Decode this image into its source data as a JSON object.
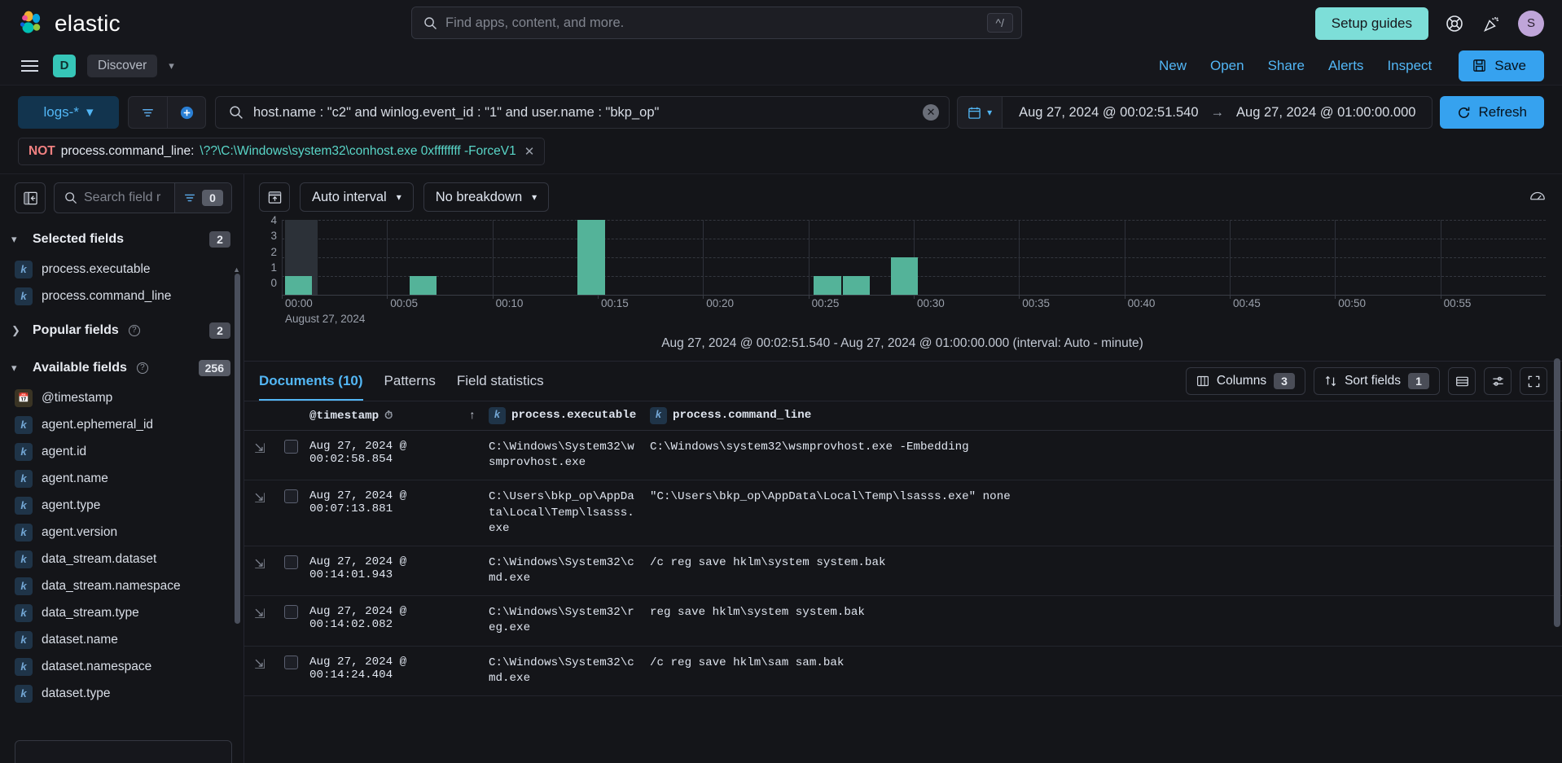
{
  "global_nav": {
    "brand": "elastic",
    "search_placeholder": "Find apps, content, and more.",
    "kbd_hint": "^/",
    "setup_guides": "Setup guides",
    "avatar_initial": "S"
  },
  "app_bar": {
    "app_badge": "D",
    "breadcrumb": "Discover",
    "links": [
      "New",
      "Open",
      "Share",
      "Alerts",
      "Inspect"
    ],
    "save_label": "Save"
  },
  "query_bar": {
    "data_view": "logs-*",
    "kql": "host.name : \"c2\" and winlog.event_id : \"1\" and user.name : \"bkp_op\"",
    "time_start": "Aug 27, 2024 @ 00:02:51.540",
    "time_arrow": "→",
    "time_end": "Aug 27, 2024 @ 01:00:00.000",
    "refresh_label": "Refresh"
  },
  "filter_pill": {
    "negation": "NOT",
    "field": "process.command_line:",
    "value": "\\??\\C:\\Windows\\system32\\conhost.exe 0xffffffff -ForceV1"
  },
  "sidebar": {
    "search_placeholder": "Search field r",
    "filter_count": "0",
    "groups": [
      {
        "name": "selected",
        "title": "Selected fields",
        "count": "2",
        "expanded": true,
        "has_help": false
      },
      {
        "name": "popular",
        "title": "Popular fields",
        "count": "2",
        "expanded": false,
        "has_help": true
      },
      {
        "name": "available",
        "title": "Available fields",
        "count": "256",
        "expanded": true,
        "has_help": true
      }
    ],
    "selected_fields": [
      {
        "name": "process.executable",
        "type": "k"
      },
      {
        "name": "process.command_line",
        "type": "k"
      }
    ],
    "available_fields": [
      {
        "name": "@timestamp",
        "type": "date"
      },
      {
        "name": "agent.ephemeral_id",
        "type": "k"
      },
      {
        "name": "agent.id",
        "type": "k"
      },
      {
        "name": "agent.name",
        "type": "k"
      },
      {
        "name": "agent.type",
        "type": "k"
      },
      {
        "name": "agent.version",
        "type": "k"
      },
      {
        "name": "data_stream.dataset",
        "type": "k"
      },
      {
        "name": "data_stream.namespace",
        "type": "k"
      },
      {
        "name": "data_stream.type",
        "type": "k"
      },
      {
        "name": "dataset.name",
        "type": "k"
      },
      {
        "name": "dataset.namespace",
        "type": "k"
      },
      {
        "name": "dataset.type",
        "type": "k"
      }
    ]
  },
  "chart_toolbar": {
    "interval": "Auto interval",
    "breakdown": "No breakdown"
  },
  "chart_data": {
    "type": "bar",
    "title": "",
    "caption": "Aug 27, 2024 @ 00:02:51.540 - Aug 27, 2024 @ 01:00:00.000 (interval: Auto - minute)",
    "xlabel": "August 27, 2024",
    "ylabel": "",
    "ylim": [
      0,
      4
    ],
    "yticks": [
      "4",
      "3",
      "2",
      "1",
      "0"
    ],
    "xticks": [
      "00:00",
      "00:05",
      "00:10",
      "00:15",
      "00:20",
      "00:25",
      "00:30",
      "00:35",
      "00:40",
      "00:45",
      "00:50",
      "00:55"
    ],
    "grid": true,
    "legend": "none",
    "bar_color": "#54b399",
    "categories": [
      "00:02",
      "00:07",
      "00:14",
      "00:25",
      "00:26",
      "00:28"
    ],
    "values": [
      1,
      1,
      4,
      1,
      1,
      2
    ]
  },
  "documents": {
    "tabs": [
      {
        "label": "Documents (10)",
        "active": true
      },
      {
        "label": "Patterns",
        "active": false
      },
      {
        "label": "Field statistics",
        "active": false
      }
    ],
    "columns_label": "Columns",
    "columns_count": "3",
    "sort_label": "Sort fields",
    "sort_count": "1",
    "headers": {
      "timestamp": "@timestamp",
      "executable": "process.executable",
      "command_line": "process.command_line"
    },
    "rows": [
      {
        "timestamp": "Aug 27, 2024 @ 00:02:58.854",
        "executable": "C:\\Windows\\System32\\wsmprovhost.exe",
        "command_line": "C:\\Windows\\system32\\wsmprovhost.exe -Embedding"
      },
      {
        "timestamp": "Aug 27, 2024 @ 00:07:13.881",
        "executable": "C:\\Users\\bkp_op\\AppData\\Local\\Temp\\lsasss.exe",
        "command_line": "\"C:\\Users\\bkp_op\\AppData\\Local\\Temp\\lsasss.exe\" none"
      },
      {
        "timestamp": "Aug 27, 2024 @ 00:14:01.943",
        "executable": "C:\\Windows\\System32\\cmd.exe",
        "command_line": "/c reg save hklm\\system system.bak"
      },
      {
        "timestamp": "Aug 27, 2024 @ 00:14:02.082",
        "executable": "C:\\Windows\\System32\\reg.exe",
        "command_line": "reg  save hklm\\system system.bak"
      },
      {
        "timestamp": "Aug 27, 2024 @ 00:14:24.404",
        "executable": "C:\\Windows\\System32\\cmd.exe",
        "command_line": "/c reg save hklm\\sam sam.bak"
      }
    ]
  }
}
